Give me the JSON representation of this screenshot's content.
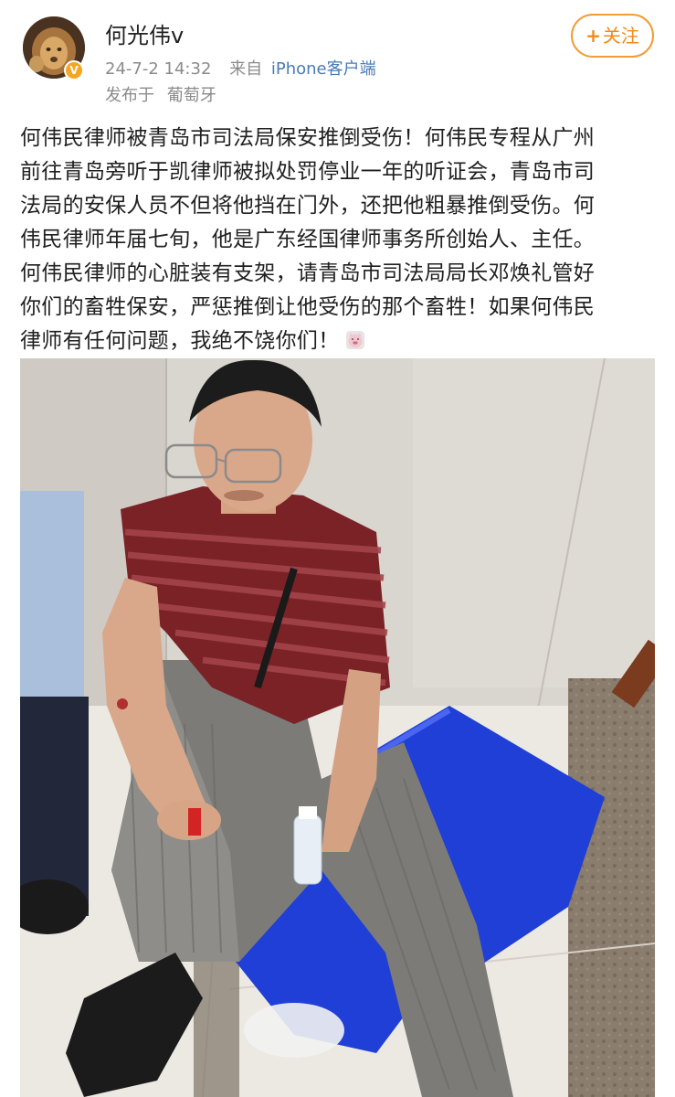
{
  "header": {
    "username": "何光伟v",
    "verified_badge": "V",
    "post_time": "24-7-2 14:32",
    "source_prefix": "来自",
    "source_client": "iPhone客户端",
    "location_prefix": "发布于",
    "location": "葡萄牙",
    "follow_plus": "+",
    "follow_label": "关注"
  },
  "post": {
    "lines": [
      "何伟民律师被青岛市司法局保安推倒受伤！何伟民专程从广州",
      "前往青岛旁听于凯律师被拟处罚停业一年的听证会，青岛市司",
      "法局的安保人员不但将他挡在门外，还把他粗暴推倒受伤。何",
      "伟民律师年届七旬，他是广东经国律师事务所创始人、主任。",
      "何伟民律师的心脏装有支架，请青岛市司法局局长邓焕礼管好",
      "你们的畜牲保安，严惩推倒让他受伤的那个畜牲！如果何伟民",
      "律师有任何问题，我绝不饶你们！"
    ],
    "emoji": "pig-face-icon"
  },
  "colors": {
    "accent_orange": "#f39b35",
    "link_blue": "#4a7bb7",
    "meta_gray": "#8a8a8a",
    "verified_gold": "#f5a623"
  }
}
